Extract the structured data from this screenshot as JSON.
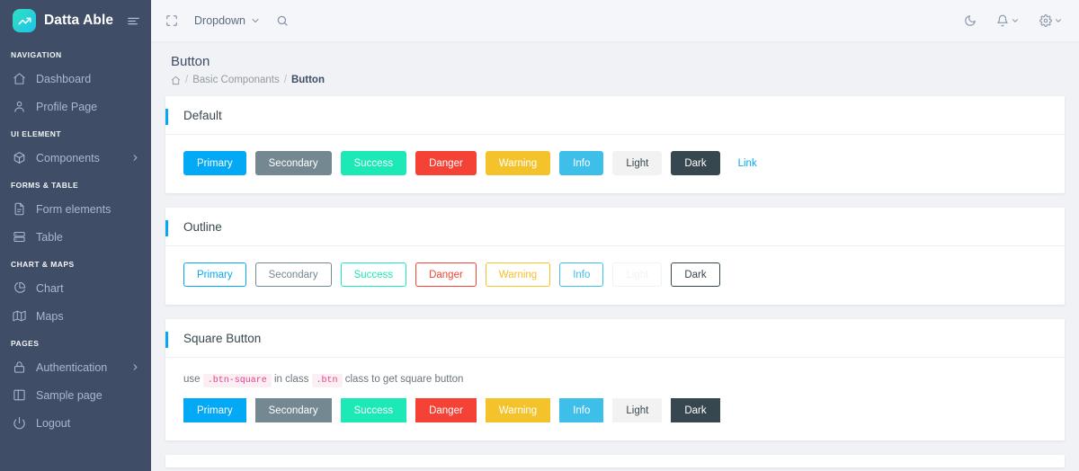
{
  "brand": {
    "name": "Datta Able",
    "logo_icon": "trending-up-icon",
    "toggle_icon": "menu-toggle-icon"
  },
  "sidebar": {
    "groups": [
      {
        "caption": "NAVIGATION",
        "items": [
          {
            "label": "Dashboard",
            "icon": "home-icon",
            "arrow": false
          },
          {
            "label": "Profile Page",
            "icon": "user-icon",
            "arrow": false
          }
        ]
      },
      {
        "caption": "UI ELEMENT",
        "items": [
          {
            "label": "Components",
            "icon": "box-icon",
            "arrow": true
          }
        ]
      },
      {
        "caption": "FORMS & TABLE",
        "items": [
          {
            "label": "Form elements",
            "icon": "file-text-icon",
            "arrow": false
          },
          {
            "label": "Table",
            "icon": "server-icon",
            "arrow": false
          }
        ]
      },
      {
        "caption": "CHART & MAPS",
        "items": [
          {
            "label": "Chart",
            "icon": "pie-chart-icon",
            "arrow": false
          },
          {
            "label": "Maps",
            "icon": "map-icon",
            "arrow": false
          }
        ]
      },
      {
        "caption": "PAGES",
        "items": [
          {
            "label": "Authentication",
            "icon": "lock-icon",
            "arrow": true
          },
          {
            "label": "Sample page",
            "icon": "sidebar-icon",
            "arrow": false
          },
          {
            "label": "Logout",
            "icon": "power-icon",
            "arrow": false
          }
        ]
      }
    ]
  },
  "topbar": {
    "fullscreen_icon": "maximize-icon",
    "dropdown_label": "Dropdown",
    "dropdown_caret_icon": "chevron-down-icon",
    "search_icon": "search-icon",
    "right": [
      {
        "icon": "moon-icon",
        "caret": false
      },
      {
        "icon": "bell-icon",
        "caret": true
      },
      {
        "icon": "gear-icon",
        "caret": true
      }
    ]
  },
  "page": {
    "title": "Button",
    "breadcrumb": {
      "home_icon": "home-icon",
      "items": [
        {
          "label": "Basic Componants",
          "current": false
        },
        {
          "label": "Button",
          "current": true
        }
      ],
      "separator": "/"
    }
  },
  "sections": {
    "default": {
      "title": "Default",
      "buttons": [
        {
          "label": "Primary",
          "bg": "#04a9f5",
          "fg": "#ffffff",
          "border": "#04a9f5"
        },
        {
          "label": "Secondary",
          "bg": "#748892",
          "fg": "#ffffff",
          "border": "#748892"
        },
        {
          "label": "Success",
          "bg": "#1de9b6",
          "fg": "#ffffff",
          "border": "#1de9b6"
        },
        {
          "label": "Danger",
          "bg": "#f44236",
          "fg": "#ffffff",
          "border": "#f44236"
        },
        {
          "label": "Warning",
          "bg": "#f4c22b",
          "fg": "#ffffff",
          "border": "#f4c22b"
        },
        {
          "label": "Info",
          "bg": "#3ebfea",
          "fg": "#ffffff",
          "border": "#3ebfea"
        },
        {
          "label": "Light",
          "bg": "#f2f2f2",
          "fg": "#37474f",
          "border": "#f2f2f2"
        },
        {
          "label": "Dark",
          "bg": "#37474f",
          "fg": "#ffffff",
          "border": "#37474f"
        }
      ],
      "link_label": "Link",
      "link_color": "#04a9f5"
    },
    "outline": {
      "title": "Outline",
      "buttons": [
        {
          "label": "Primary",
          "fg": "#04a9f5",
          "border": "#04a9f5"
        },
        {
          "label": "Secondary",
          "fg": "#748892",
          "border": "#748892"
        },
        {
          "label": "Success",
          "fg": "#1de9b6",
          "border": "#1de9b6"
        },
        {
          "label": "Danger",
          "fg": "#f44236",
          "border": "#f44236"
        },
        {
          "label": "Warning",
          "fg": "#f4c22b",
          "border": "#f4c22b"
        },
        {
          "label": "Info",
          "fg": "#3ebfea",
          "border": "#3ebfea"
        },
        {
          "label": "Light",
          "fg": "#f2f2f2",
          "border": "#f2f2f2"
        },
        {
          "label": "Dark",
          "fg": "#37474f",
          "border": "#37474f"
        }
      ]
    },
    "square": {
      "title": "Square Button",
      "hint": {
        "pre": "use",
        "code1": ".btn-square",
        "mid": "in class",
        "code2": ".btn",
        "post": "class to get square button"
      },
      "buttons": [
        {
          "label": "Primary",
          "bg": "#04a9f5",
          "fg": "#ffffff"
        },
        {
          "label": "Secondary",
          "bg": "#748892",
          "fg": "#ffffff"
        },
        {
          "label": "Success",
          "bg": "#1de9b6",
          "fg": "#ffffff"
        },
        {
          "label": "Danger",
          "bg": "#f44236",
          "fg": "#ffffff"
        },
        {
          "label": "Warning",
          "bg": "#f4c22b",
          "fg": "#ffffff"
        },
        {
          "label": "Info",
          "bg": "#3ebfea",
          "fg": "#ffffff"
        },
        {
          "label": "Light",
          "bg": "#f2f2f2",
          "fg": "#37474f"
        },
        {
          "label": "Dark",
          "bg": "#37474f",
          "fg": "#ffffff"
        }
      ]
    }
  }
}
